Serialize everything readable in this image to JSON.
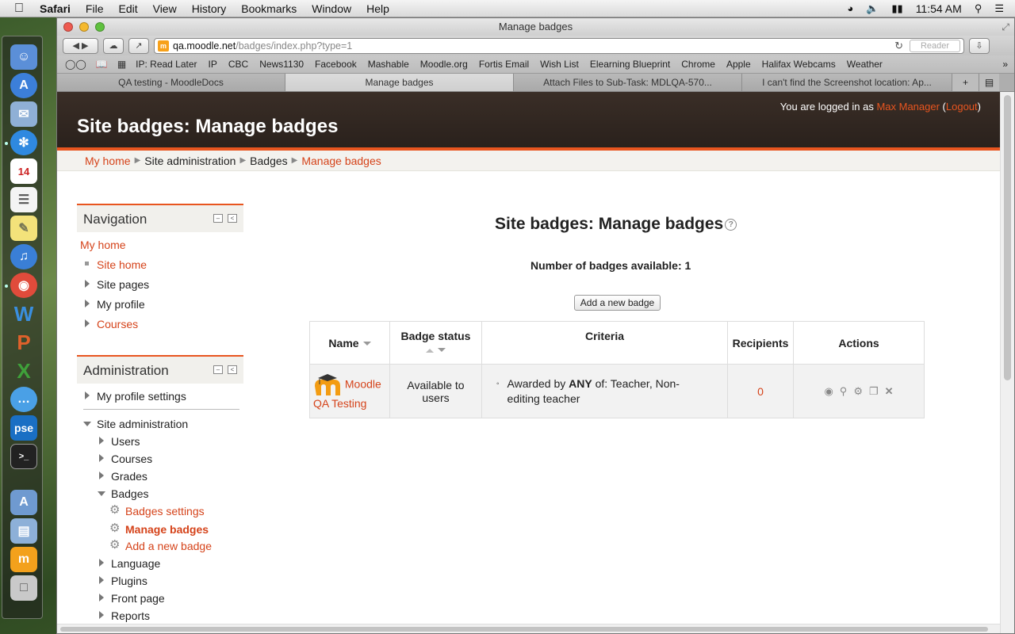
{
  "menubar": {
    "app": "Safari",
    "items": [
      "File",
      "Edit",
      "View",
      "History",
      "Bookmarks",
      "Window",
      "Help"
    ],
    "clock": "11:54 AM"
  },
  "window": {
    "title": "Manage badges"
  },
  "toolbar": {
    "url_host": "qa.moodle.net",
    "url_path": "/badges/index.php?type=1",
    "reader": "Reader"
  },
  "bookmarks": [
    "IP: Read Later",
    "IP",
    "CBC",
    "News1130",
    "Facebook",
    "Mashable",
    "Moodle.org",
    "Fortis Email",
    "Wish List",
    "Elearning Blueprint",
    "Chrome",
    "Apple",
    "Halifax Webcams",
    "Weather"
  ],
  "tabs": [
    {
      "label": "QA testing - MoodleDocs",
      "active": false
    },
    {
      "label": "Manage badges",
      "active": true
    },
    {
      "label": "Attach Files to Sub-Task: MDLQA-570...",
      "active": false
    },
    {
      "label": "I can't find the Screenshot location: Ap...",
      "active": false
    }
  ],
  "header": {
    "login_prefix": "You are logged in as ",
    "user": "Max Manager",
    "logout": "Logout",
    "title": "Site badges: Manage badges"
  },
  "breadcrumb": [
    "My home",
    "Site administration",
    "Badges",
    "Manage badges"
  ],
  "navigation": {
    "title": "Navigation",
    "my_home": "My home",
    "site_home": "Site home",
    "site_pages": "Site pages",
    "my_profile": "My profile",
    "courses": "Courses"
  },
  "administration": {
    "title": "Administration",
    "my_profile_settings": "My profile settings",
    "site_administration": "Site administration",
    "users": "Users",
    "courses": "Courses",
    "grades": "Grades",
    "badges": "Badges",
    "badges_settings": "Badges settings",
    "manage_badges": "Manage badges",
    "add_new_badge": "Add a new badge",
    "language": "Language",
    "plugins": "Plugins",
    "front_page": "Front page",
    "reports": "Reports"
  },
  "main": {
    "title": "Site badges: Manage badges",
    "count": "Number of badges available: 1",
    "add_button": "Add a new badge",
    "columns": [
      "Name",
      "Badge status",
      "Criteria",
      "Recipients",
      "Actions"
    ],
    "rows": [
      {
        "name_line1": "Moodle",
        "name_line2": "QA Testing",
        "status": "Available to users",
        "criteria_prefix": "Awarded by ",
        "criteria_bold": "ANY",
        "criteria_suffix": " of: Teacher, Non-editing teacher",
        "recipients": "0"
      }
    ]
  },
  "colors": {
    "accent": "#e8551f",
    "header_bg": "#2f2520"
  }
}
